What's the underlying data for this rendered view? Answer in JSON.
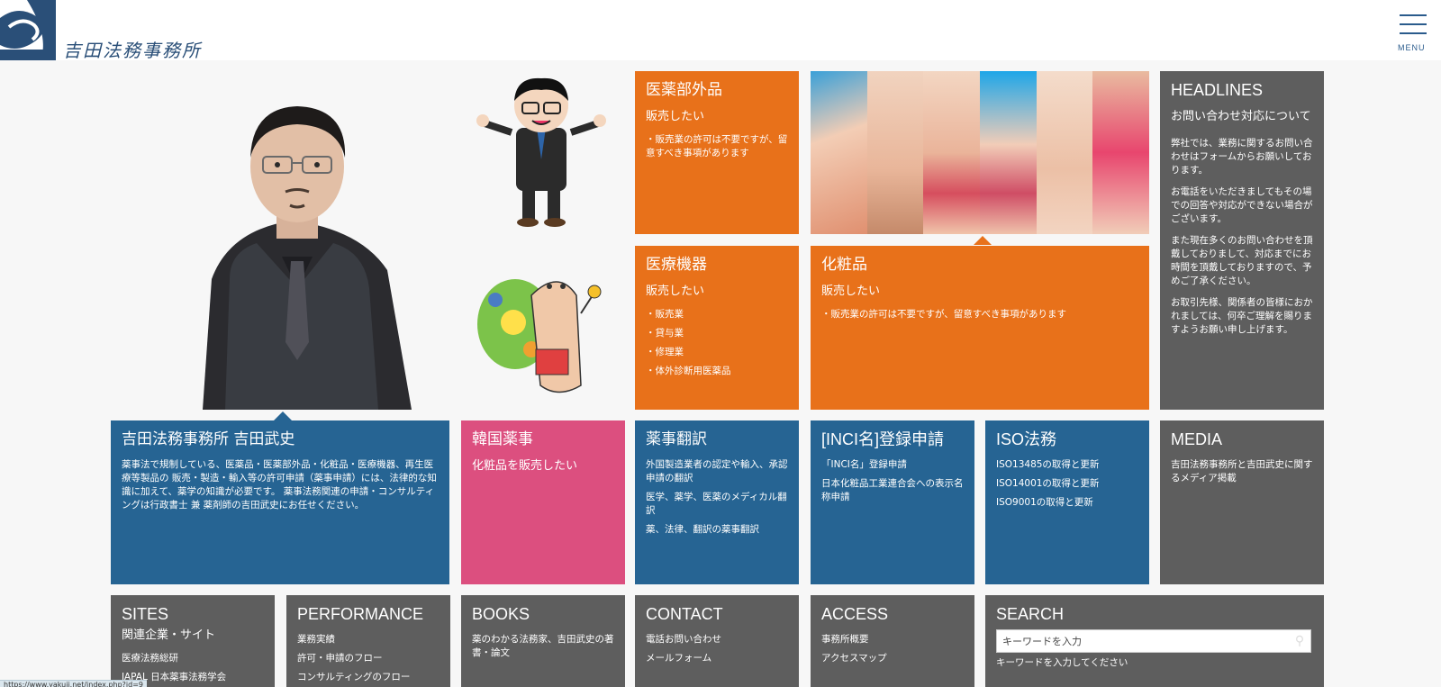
{
  "header": {
    "site_name": "吉田法務事務所",
    "menu_label": "MENU"
  },
  "tiles": {
    "quasi_drugs": {
      "title": "医薬部外品",
      "subtitle": "販売したい",
      "items": [
        "・販売業の許可は不要ですが、留意すべき事項があります"
      ]
    },
    "medical_devices": {
      "title": "医療機器",
      "subtitle": "販売したい",
      "items": [
        "・販売業",
        "・貸与業",
        "・修理業",
        "・体外診断用医薬品"
      ]
    },
    "cosmetics": {
      "title": "化粧品",
      "subtitle": "販売したい",
      "items": [
        "・販売業の許可は不要ですが、留意すべき事項があります"
      ]
    },
    "headlines": {
      "title": "HEADLINES",
      "subtitle": "お問い合わせ対応について",
      "paragraphs": [
        "弊社では、業務に関するお問い合わせはフォームからお願いしております。",
        "お電話をいただきましてもその場での回答や対応ができない場合がございます。",
        "また現在多くのお問い合わせを頂戴しておりまして、対応までにお時間を頂戴しておりますので、予めご了承ください。",
        "お取引先様、関係者の皆様におかれましては、何卒ご理解を賜りますようお願い申し上げます。"
      ]
    },
    "profile": {
      "title": "吉田法務事務所 吉田武史",
      "body": "薬事法で規制している、医薬品・医薬部外品・化粧品・医療機器、再生医療等製品の 販売・製造・輸入等の許可申請（薬事申請）には、法律的な知識に加えて、薬学の知識が必要です。 薬事法務関連の申請・コンサルティングは行政書士 兼 薬剤師の吉田武史にお任せください。"
    },
    "korea": {
      "title": "韓国薬事",
      "subtitle": "化粧品を販売したい"
    },
    "translation": {
      "title": "薬事翻訳",
      "items": [
        "外国製造業者の認定や輸入、承認申請の翻訳",
        "医学、薬学、医薬のメディカル翻訳",
        "薬、法律、翻訳の薬事翻訳"
      ]
    },
    "inci": {
      "title": "[INCI名]登録申請",
      "items": [
        "「INCI名」登録申請",
        "日本化粧品工業連合会への表示名称申請"
      ]
    },
    "iso": {
      "title": "ISO法務",
      "items": [
        "ISO13485の取得と更新",
        "ISO14001の取得と更新",
        "ISO9001の取得と更新"
      ]
    },
    "media": {
      "title": "MEDIA",
      "items": [
        "吉田法務事務所と吉田武史に関するメディア掲載"
      ]
    },
    "sites": {
      "title": "SITES",
      "subtitle": "関連企業・サイト",
      "items": [
        "医療法務総研",
        "JAPAL 日本薬事法務学会"
      ]
    },
    "performance": {
      "title": "PERFORMANCE",
      "items": [
        "業務実績",
        "許可・申請のフロー",
        "コンサルティングのフロー"
      ]
    },
    "books": {
      "title": "BOOKS",
      "items": [
        "薬のわかる法務家、吉田武史の著書・論文"
      ]
    },
    "contact": {
      "title": "CONTACT",
      "items": [
        "電話お問い合わせ",
        "メールフォーム"
      ]
    },
    "access": {
      "title": "ACCESS",
      "items": [
        "事務所概要",
        "アクセスマップ"
      ]
    },
    "search": {
      "title": "SEARCH",
      "placeholder": "キーワードを入力",
      "hint": "キーワードを入力してください"
    }
  },
  "statusbar": {
    "url": "https://www.yakuji.net/index.php?id=9"
  },
  "colors": {
    "orange": "#e8711a",
    "grey": "#5e5e5e",
    "blue": "#266493",
    "pink": "#dc4f7f",
    "brand": "#2a4f78"
  },
  "icons": [
    "logo-mark",
    "menu-hamburger-icon",
    "search-icon"
  ]
}
